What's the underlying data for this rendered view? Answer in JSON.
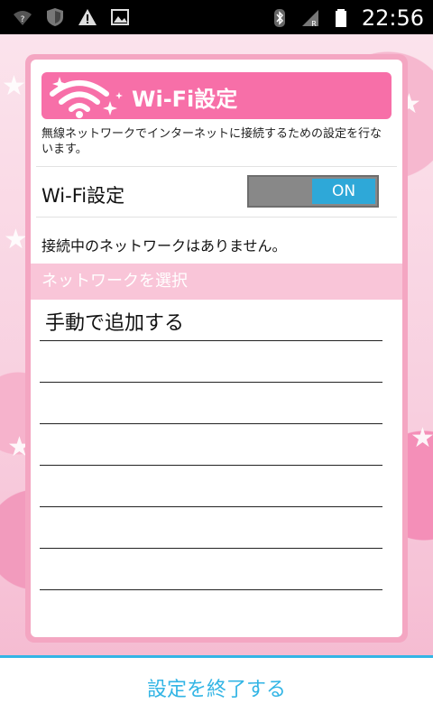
{
  "status_bar": {
    "time": "22:56",
    "icons": [
      "wifi-question-icon",
      "shield-icon",
      "warning-icon",
      "image-icon",
      "bluetooth-icon",
      "signal-icon",
      "battery-icon"
    ]
  },
  "header": {
    "title": "Wi-Fi設定",
    "description": "無線ネットワークでインターネットに接続するための設定を行ないます。"
  },
  "wifi_toggle": {
    "label": "Wi-Fi設定",
    "state": "ON"
  },
  "connection_status": "接続中のネットワークはありません。",
  "network_section": {
    "header": "ネットワークを選択",
    "items": [
      {
        "label": "手動で追加する"
      },
      {
        "label": ""
      },
      {
        "label": ""
      },
      {
        "label": ""
      },
      {
        "label": ""
      },
      {
        "label": ""
      },
      {
        "label": ""
      }
    ]
  },
  "footer": {
    "finish_label": "設定を終了する"
  },
  "colors": {
    "accent_pink": "#f76fa8",
    "section_pink": "#f9c5d8",
    "toggle_blue": "#2ea8d8",
    "action_blue": "#33b5e5"
  }
}
